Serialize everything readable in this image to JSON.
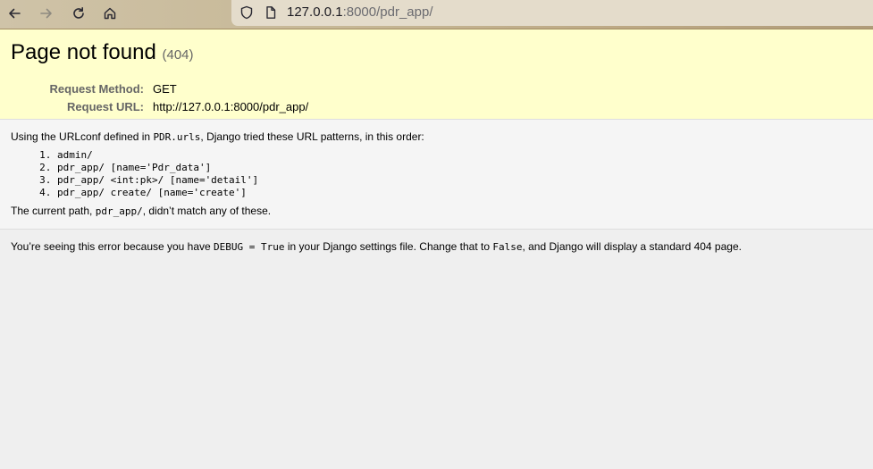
{
  "browser": {
    "url_host": "127.0.0.1",
    "url_rest": ":8000/pdr_app/"
  },
  "summary": {
    "title": "Page not found",
    "code": "(404)",
    "meta": [
      {
        "label": "Request Method:",
        "value": "GET"
      },
      {
        "label": "Request URL:",
        "value": "http://127.0.0.1:8000/pdr_app/"
      }
    ]
  },
  "info": {
    "intro_before": "Using the URLconf defined in ",
    "urlconf": "PDR.urls",
    "intro_after": ", Django tried these URL patterns, in this order:",
    "patterns": [
      "admin/",
      "pdr_app/ [name='Pdr_data']",
      "pdr_app/ <int:pk>/ [name='detail']",
      "pdr_app/ create/ [name='create']"
    ],
    "current_before": "The current path, ",
    "current_path": "pdr_app/",
    "current_after": ", didn’t match any of these."
  },
  "explanation": {
    "part1": "You’re seeing this error because you have ",
    "code1": "DEBUG = True",
    "part2": " in your Django settings file. Change that to ",
    "code2": "False",
    "part3": ", and Django will display a standard 404 page."
  }
}
